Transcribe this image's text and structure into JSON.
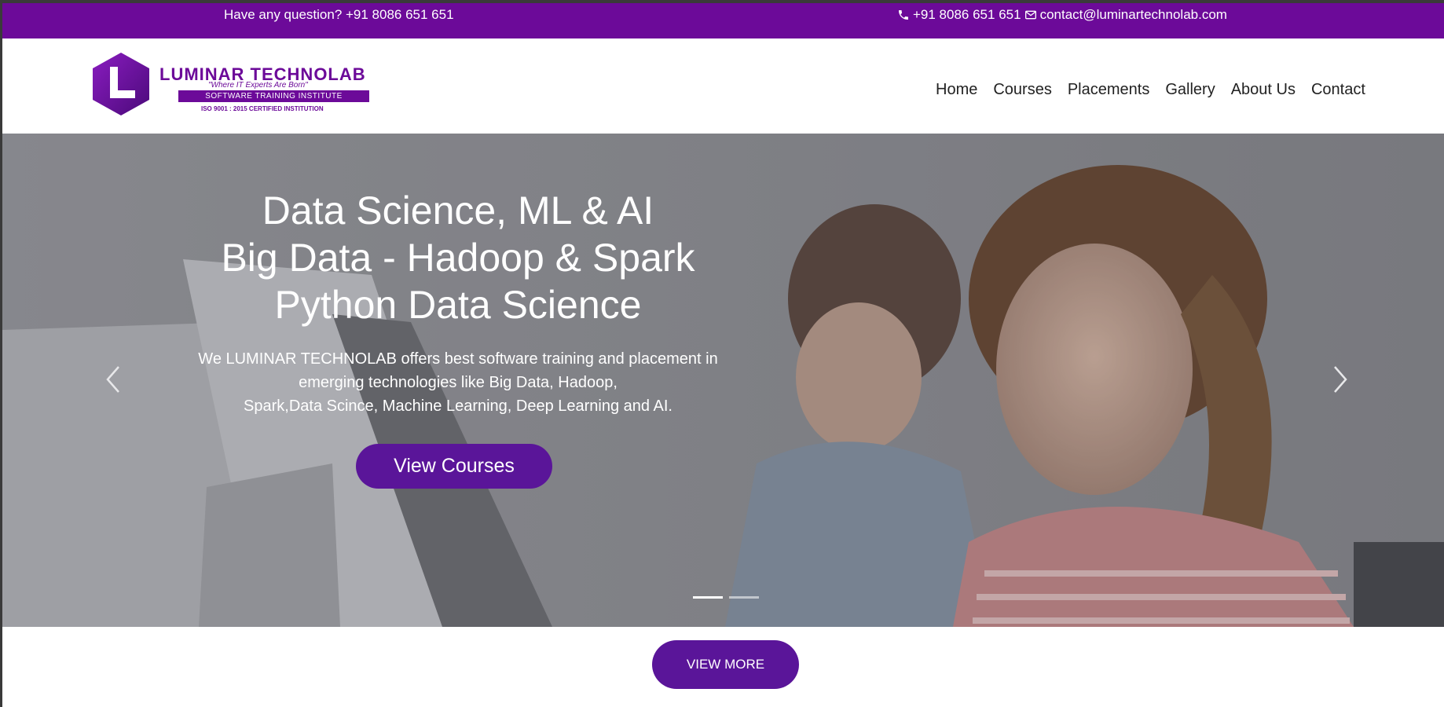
{
  "topbar": {
    "question": "Have any question? +91 8086 651 651",
    "phone": "+91 8086 651 651",
    "email": "contact@luminartechnolab.com",
    "phone_icon": "phone-icon",
    "email_icon": "envelope-icon",
    "bg_color": "#6c0a99"
  },
  "header": {
    "brand": "LUMINAR TECHNOLAB",
    "tagline": "\"Where IT Experts Are Born\"",
    "subtitle": "SOFTWARE TRAINING INSTITUTE",
    "certification": "ISO 9001 : 2015 CERTIFIED INSTITUTION",
    "nav": [
      "Home",
      "Courses",
      "Placements",
      "Gallery",
      "About Us",
      "Contact"
    ]
  },
  "hero": {
    "title_lines": [
      "Data Science, ML & AI",
      "Big Data - Hadoop & Spark",
      "Python Data Science"
    ],
    "description_lines": [
      "We LUMINAR TECHNOLAB offers best software training and placement in",
      "emerging technologies like Big Data, Hadoop,",
      "Spark,Data Scince, Machine Learning, Deep Learning and AI."
    ],
    "cta": "View Courses",
    "prev_icon": "chevron-left-icon",
    "next_icon": "chevron-right-icon",
    "slides_total": 2,
    "active_slide": 1,
    "accent_color": "#5a1599"
  },
  "view_more": "VIEW MORE"
}
